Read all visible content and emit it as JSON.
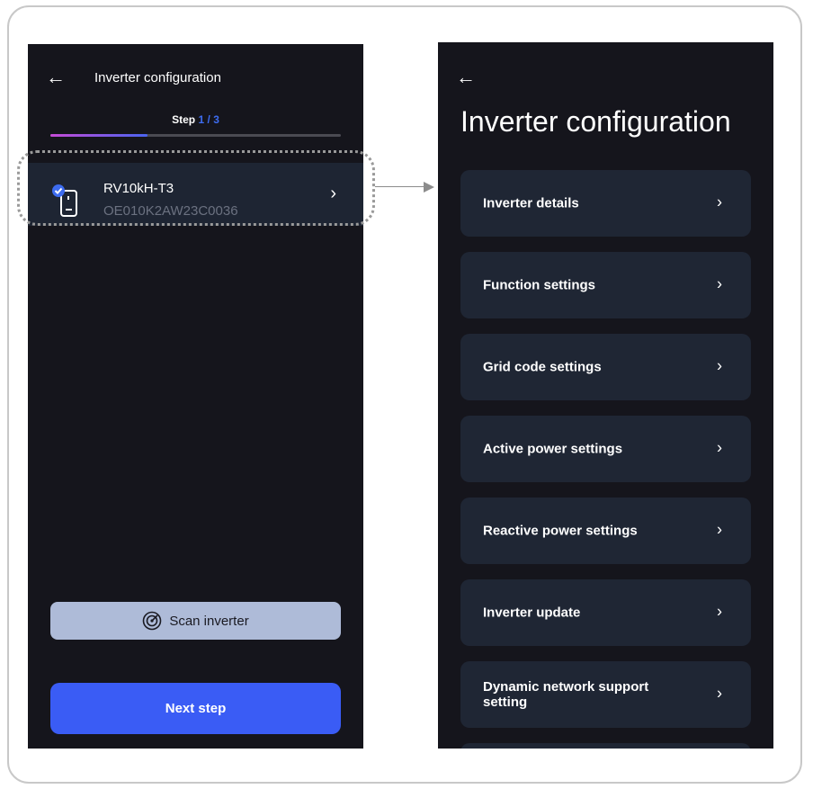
{
  "left_screen": {
    "back_icon": "arrow-left-icon",
    "title": "Inverter configuration",
    "step": {
      "label": "Step",
      "current": "1",
      "separator": " / ",
      "total": "3"
    },
    "progress": 0.333,
    "device": {
      "name": "RV10kH-T3",
      "serial": "OE010K2AW23C0036",
      "icon": "inverter-check-icon",
      "status_color": "#3d6cf0"
    },
    "scan_button": {
      "label": "Scan inverter",
      "icon": "radar-icon"
    },
    "next_button": {
      "label": "Next step"
    }
  },
  "right_screen": {
    "back_icon": "arrow-left-icon",
    "title": "Inverter configuration",
    "menu": [
      {
        "label": "Inverter details"
      },
      {
        "label": "Function settings"
      },
      {
        "label": "Grid code settings"
      },
      {
        "label": "Active power settings"
      },
      {
        "label": "Reactive power settings"
      },
      {
        "label": "Inverter update"
      },
      {
        "label": "Dynamic network support setting"
      }
    ]
  },
  "colors": {
    "screen_bg": "#15151c",
    "card_bg": "#1f2634",
    "accent": "#3a5cf5",
    "scan_bg": "#aebbd8"
  }
}
